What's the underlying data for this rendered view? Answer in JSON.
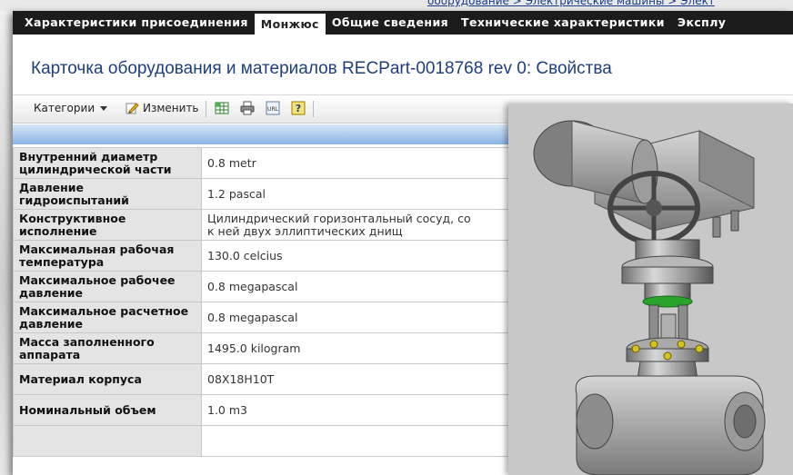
{
  "background": {
    "crumbs": "оборудование > Электрические машины > Элект"
  },
  "tabs": [
    {
      "label": "Характеристики присоединения"
    },
    {
      "label": "Монжюс"
    },
    {
      "label": "Общие сведения"
    },
    {
      "label": "Технические характеристики"
    },
    {
      "label": "Эксплу"
    }
  ],
  "active_tab": "Монжюс",
  "page_title": "Карточка оборудования и материалов RECPart-0018768 rev 0: Свойства",
  "toolbar": {
    "categories_label": "Категори",
    "edit_label": "Изменить",
    "icons": [
      "categories-dropdown-icon",
      "edit-pencil-icon",
      "spreadsheet-icon",
      "print-icon",
      "url-icon",
      "help-icon"
    ]
  },
  "properties": [
    {
      "key": "Внутренний диаметр цилиндрической части",
      "value": "0.8 metr"
    },
    {
      "key": "Давление гидроиспытаний",
      "value": "1.2 pascal"
    },
    {
      "key": "Конструктивное исполнение",
      "value": "Цилиндрический горизонтальный сосуд, со\nк ней двух эллиптических днищ"
    },
    {
      "key": "Максимальная рабочая температура",
      "value": "130.0 celcius"
    },
    {
      "key": "Максимальное рабочее давление",
      "value": "0.8 megapascal"
    },
    {
      "key": "Максимальное расчетное давление",
      "value": "0.8 megapascal"
    },
    {
      "key": "Масса заполненного аппарата",
      "value": "1495.0 kilogram"
    },
    {
      "key": "Материал корпуса",
      "value": "08X18H10T"
    },
    {
      "key": "Номинальный объем",
      "value": "1.0 m3"
    },
    {
      "key": "",
      "value": ""
    }
  ],
  "colors": {
    "tab_bar": "#1c1c1c",
    "title": "#1d3f7d",
    "header_band": "#8ab3e6",
    "key_cell": "#e4e4e4"
  }
}
